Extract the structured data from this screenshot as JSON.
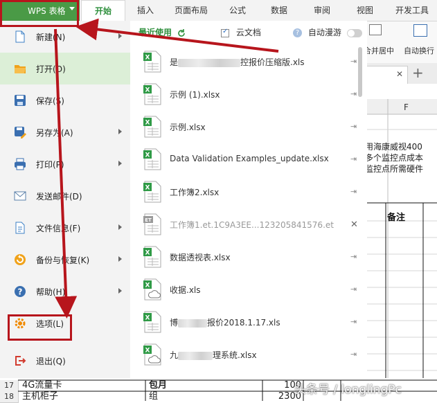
{
  "app": {
    "menu_label": "WPS 表格"
  },
  "tabs": [
    {
      "label": "开始",
      "active": true
    },
    {
      "label": "插入"
    },
    {
      "label": "页面布局"
    },
    {
      "label": "公式"
    },
    {
      "label": "数据"
    },
    {
      "label": "审阅"
    },
    {
      "label": "视图"
    },
    {
      "label": "开发工具"
    }
  ],
  "ribbon": {
    "merge_center": "合并居中",
    "auto_wrap": "自动换行"
  },
  "sheet": {
    "col_f_header": "F",
    "note_line1": "用海康威视400",
    "note_line2": "多个监控点成本",
    "note_line3": "监控点所需硬件",
    "remarks_header": "备注"
  },
  "file_menu": {
    "items": [
      {
        "label": "新建(N)",
        "has_arrow": true
      },
      {
        "label": "打开(O)",
        "highlight": true
      },
      {
        "label": "保存(S)"
      },
      {
        "label": "另存为(A)",
        "has_arrow": true
      },
      {
        "label": "打印(P)",
        "has_arrow": true
      },
      {
        "label": "发送邮件(D)"
      },
      {
        "label": "文件信息(F)",
        "has_arrow": true
      },
      {
        "label": "备份与恢复(K)",
        "has_arrow": true
      },
      {
        "label": "帮助(H)",
        "has_arrow": true
      },
      {
        "label": "选项(L)"
      },
      {
        "label": "退出(Q)"
      }
    ]
  },
  "recent": {
    "title": "最近使用",
    "cloud_doc": "云文档",
    "auto_roam": "自动漫游",
    "files": [
      {
        "prefix": "是",
        "name": "控报价压缩版.xls",
        "type": "xls"
      },
      {
        "prefix": "",
        "name": "示例 (1).xlsx",
        "type": "xls"
      },
      {
        "prefix": "",
        "name": "示例.xlsx",
        "type": "xls"
      },
      {
        "prefix": "",
        "name": "Data Validation Examples_update.xlsx",
        "type": "xls"
      },
      {
        "prefix": "",
        "name": "工作簿2.xlsx",
        "type": "xls"
      },
      {
        "prefix": "",
        "name": "工作簿1.et.1C9A3EE...123205841576.et",
        "type": "et",
        "closable": true
      },
      {
        "prefix": "",
        "name": "数据透视表.xlsx",
        "type": "xls"
      },
      {
        "prefix": "",
        "name": "收据.xls",
        "type": "cloud"
      },
      {
        "prefix": "博",
        "name": "报价2018.1.17.xls",
        "type": "xls"
      },
      {
        "prefix": "九",
        "name": "理系统.xlsx",
        "type": "cloud"
      }
    ]
  },
  "bottom_rows": [
    {
      "num": "17",
      "item": "4G流量卡",
      "unit": "包月",
      "qty": "100"
    },
    {
      "num": "18",
      "item": "主机柜子",
      "unit": "组",
      "qty": "2300"
    }
  ],
  "watermark": "头条号 / longlingPc",
  "colors": {
    "accent": "#2e8f3c",
    "annotation": "#b7151c",
    "highlight": "#dcefd7"
  }
}
